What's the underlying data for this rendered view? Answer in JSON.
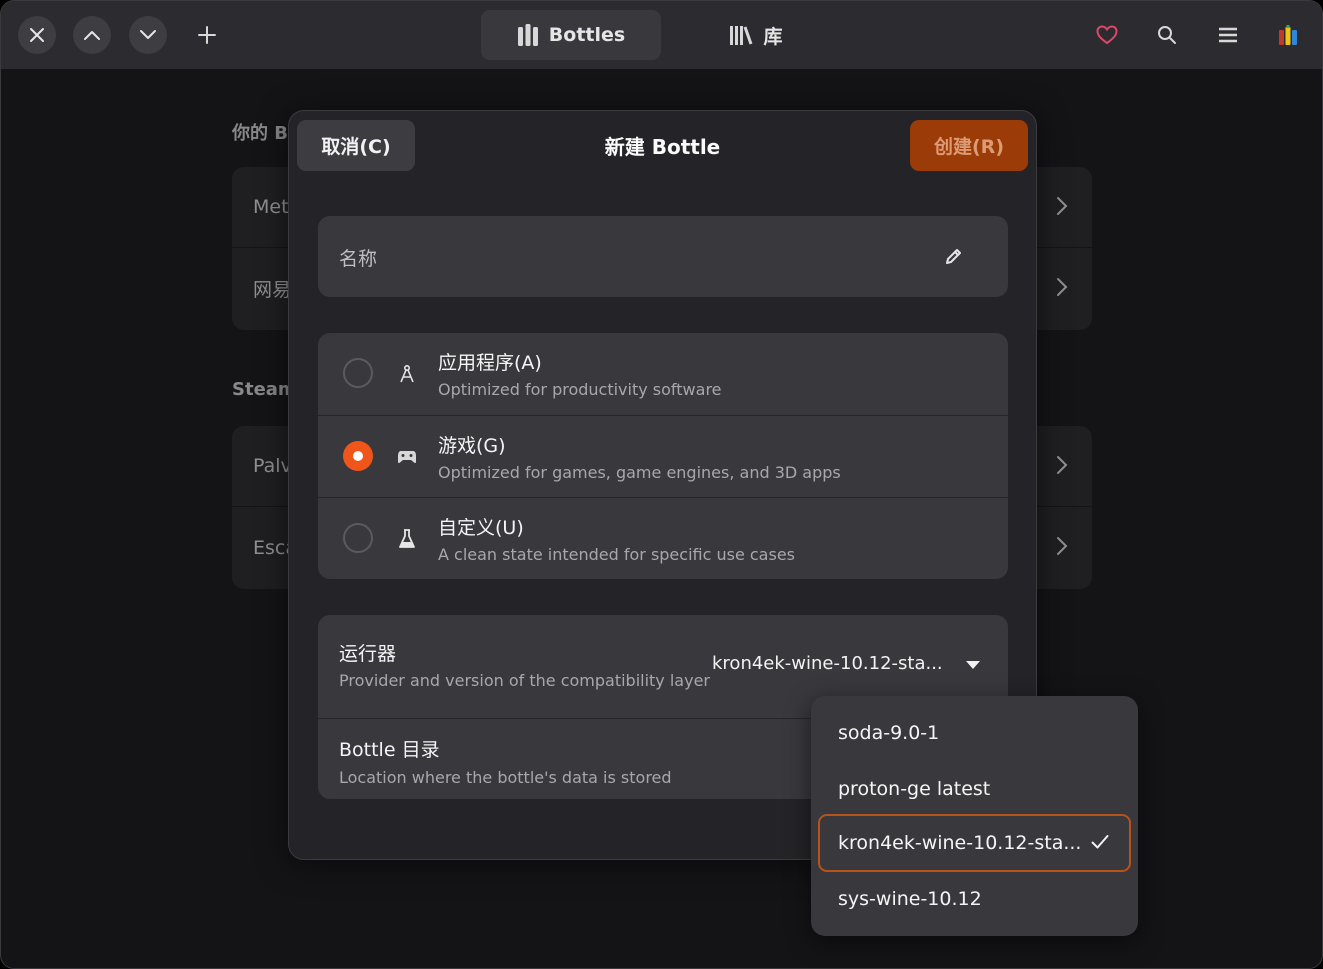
{
  "header": {
    "close_icon": "close-icon",
    "prev_icon": "chevron-up-icon",
    "next_icon": "chevron-down-icon",
    "add_icon": "plus-icon",
    "tabs": [
      {
        "label": "Bottles",
        "icon": "bottles-icon",
        "active": true
      },
      {
        "label": "库",
        "icon": "library-icon",
        "active": false
      }
    ],
    "right_icons": [
      "heart-icon",
      "search-icon",
      "menu-icon",
      "app-logo-icon"
    ],
    "heart_color": "#e0456a"
  },
  "background": {
    "section1_title": "你的 B",
    "section1_rows": [
      "Met",
      "网易"
    ],
    "section2_title": "Steam",
    "section2_rows": [
      "Palv",
      "Esca"
    ]
  },
  "dialog": {
    "cancel_label": "取消(C)",
    "title": "新建 Bottle",
    "create_label": "创建(R)",
    "name_placeholder": "名称",
    "types": [
      {
        "title": "应用程序(A)",
        "subtitle": "Optimized for productivity software",
        "icon": "compass-icon",
        "selected": false
      },
      {
        "title": "游戏(G)",
        "subtitle": "Optimized for games, game engines, and 3D apps",
        "icon": "gamepad-icon",
        "selected": true
      },
      {
        "title": "自定义(U)",
        "subtitle": "A clean state intended for specific use cases",
        "icon": "flask-icon",
        "selected": false
      }
    ],
    "runner": {
      "title": "运行器",
      "subtitle": "Provider and version of the compatibility layer",
      "value": "kron4ek-wine-10.12-sta..."
    },
    "directory": {
      "title": "Bottle 目录",
      "subtitle": "Location where the bottle's data is stored"
    }
  },
  "runner_popover": {
    "options": [
      "soda-9.0-1",
      "proton-ge latest",
      "kron4ek-wine-10.12-sta...",
      "sys-wine-10.12"
    ],
    "selected_index": 2
  },
  "colors": {
    "accent": "#f0561a",
    "create_button": "#9b3c08",
    "selection_border": "#b8521c"
  }
}
